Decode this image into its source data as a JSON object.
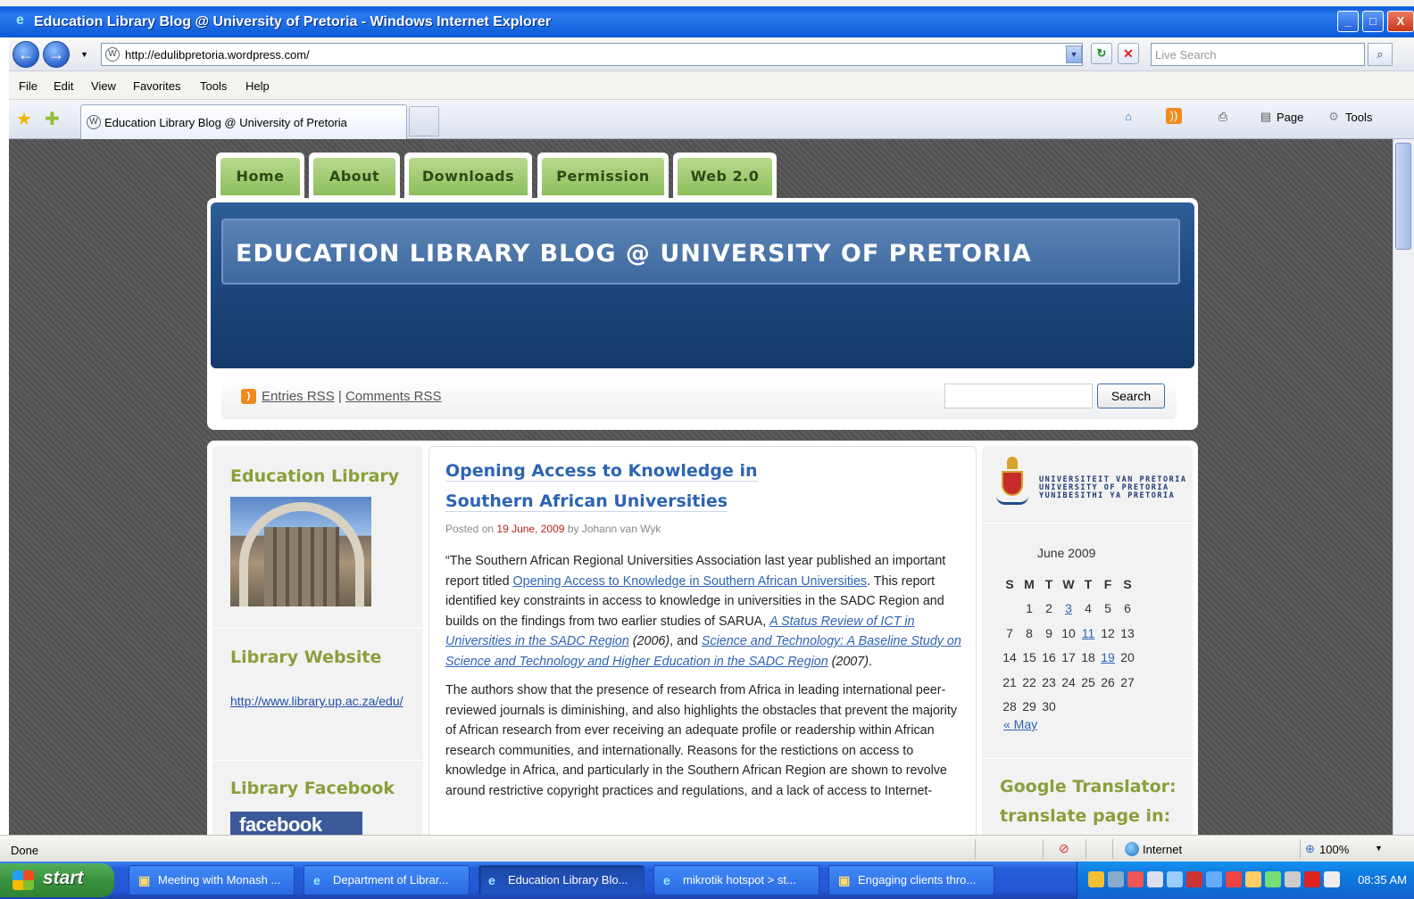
{
  "window": {
    "title": "Education Library Blog @ University of Pretoria - Windows Internet Explorer",
    "buttons": {
      "minimize": "_",
      "maximize": "□",
      "close": "X"
    }
  },
  "address_bar": {
    "url": "http://edulibpretoria.wordpress.com/",
    "live_search_placeholder": "Live Search"
  },
  "menu": [
    "File",
    "Edit",
    "View",
    "Favorites",
    "Tools",
    "Help"
  ],
  "tab": {
    "label": "Education Library Blog @ University of Pretoria"
  },
  "command_bar": {
    "page": "Page",
    "tools": "Tools"
  },
  "site": {
    "nav": [
      "Home",
      "About",
      "Downloads",
      "Permission",
      "Web 2.0"
    ],
    "title": "EDUCATION LIBRARY BLOG @ UNIVERSITY OF PRETORIA",
    "rss": {
      "entries": "Entries RSS",
      "separator": "|",
      "comments": "Comments RSS"
    },
    "search_button": "Search"
  },
  "left_sidebar": {
    "education_library": "Education Library",
    "library_website": "Library Website",
    "library_website_url": "http://www.library.up.ac.za/edu/",
    "library_facebook": "Library Facebook",
    "facebook_badge": "facebook"
  },
  "post": {
    "title": "Opening Access to Knowledge in Southern African Universities",
    "meta_prefix": "Posted on",
    "date": "19 June, 2009",
    "meta_by": "by Johann van Wyk",
    "p1_a": "“The Southern African Regional Universities Association last year published an important report titled",
    "p1_link1": "Opening Access to Knowledge in Southern African Universities",
    "p1_b": ". This report identified key constraints in access to knowledge in universities in the SADC Region and builds on the findings from two earlier studies of  SARUA,",
    "p1_link2": "A Status Review of ICT in Universities in the SADC Region",
    "p1_c": "(2006)",
    "p1_d": ", and",
    "p1_link3": "Science and Technology: A Baseline Study on Science and Technology and Higher Education in the SADC Region",
    "p1_e": "(2007)",
    "p1_f": ".",
    "p2": "The authors show that the presence of research from Africa in leading international peer-reviewed journals is diminishing, and also highlights the obstacles that prevent the majority of African research from ever receiving an adequate profile or readership within African research communities, and internationally. Reasons for the restictions on access to knowledge in Africa, and particularly in the Southern African Region are shown to revolve around restrictive copyright practices and regulations, and a lack of access to Internet-"
  },
  "right_sidebar": {
    "logo_lines": [
      "UNIVERSITEIT VAN PRETORIA",
      "UNIVERSITY OF PRETORIA",
      "YUNIBESITHI YA PRETORIA"
    ],
    "calendar": {
      "caption": "June 2009",
      "headers": [
        "S",
        "M",
        "T",
        "W",
        "T",
        "F",
        "S"
      ],
      "prev": "« May"
    },
    "google_translator": "Google Translator: translate page in:"
  },
  "status_bar": {
    "status": "Done",
    "zone": "Internet",
    "zoom": "100%"
  },
  "taskbar": {
    "start": "start",
    "items": [
      "Meeting with Monash ...",
      "Department of Librar...",
      "Education Library Blo...",
      "mikrotik hotspot > st...",
      "Engaging clients thro..."
    ],
    "clock": "08:35 AM"
  },
  "colors": {
    "xp_blue": "#245edb",
    "banner_blue": "#1e4a80",
    "tab_green": "#8dbf5c",
    "widget_heading": "#8a9f3a",
    "link_blue": "#2d64b4",
    "date_red": "#b3261e"
  }
}
